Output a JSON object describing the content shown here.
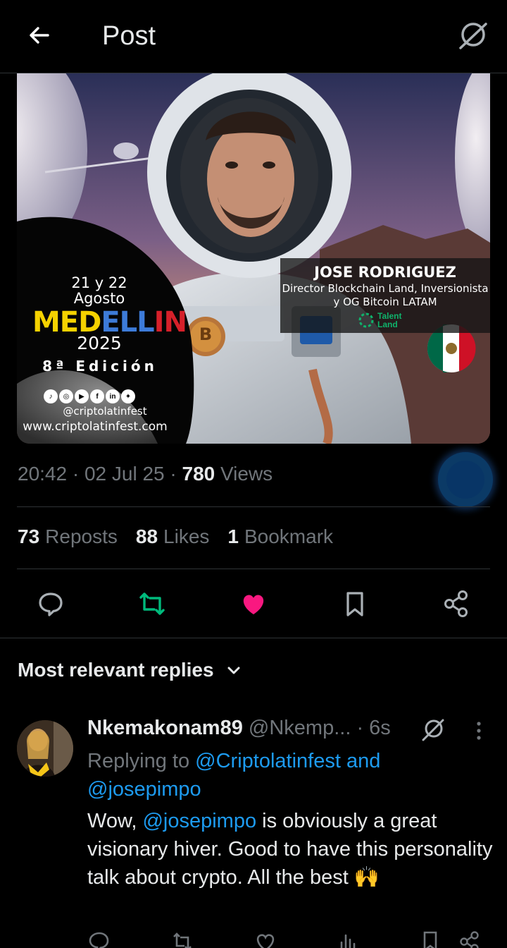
{
  "header": {
    "title": "Post"
  },
  "poster": {
    "dates": "21 y 22\nAgosto",
    "city_parts": [
      "MED",
      "ELL",
      "IN"
    ],
    "year": "2025",
    "edition": "8ª Edición",
    "handle": "@criptolatinfest",
    "website": "www.criptolatinfest.com",
    "speaker_name": "JOSE RODRIGUEZ",
    "speaker_role": "Director Blockchain Land, Inversionista y OG Bitcoin LATAM",
    "sponsor": "Talent Land",
    "sponsor_line1": "Talent",
    "sponsor_line2": "Land",
    "bitcoin_symbol": "B"
  },
  "meta": {
    "time": "20:42",
    "date": "02 Jul 25",
    "views_count": "780",
    "views_label": "Views"
  },
  "stats": [
    {
      "count": "73",
      "label": "Reposts"
    },
    {
      "count": "88",
      "label": "Likes"
    },
    {
      "count": "1",
      "label": "Bookmark"
    }
  ],
  "colors": {
    "like": "#f91880",
    "repost": "#00ba7c",
    "link": "#1d9bf0",
    "muted": "#71767b"
  },
  "replies_section": {
    "title": "Most relevant replies"
  },
  "reply": {
    "name": "Nkemakonam89",
    "handle": "@Nkemp...",
    "time": "· 6s",
    "replying_prefix": "Replying to",
    "replying_mention1": "@Criptolatinfest",
    "replying_and": "and",
    "replying_mention2": "@josepimpo",
    "text_before": "Wow,",
    "text_mention": "@josepimpo",
    "text_after": "is obviously a great visionary hiver. Good to have this personality talk about crypto. All the best",
    "emoji": "🙌"
  }
}
